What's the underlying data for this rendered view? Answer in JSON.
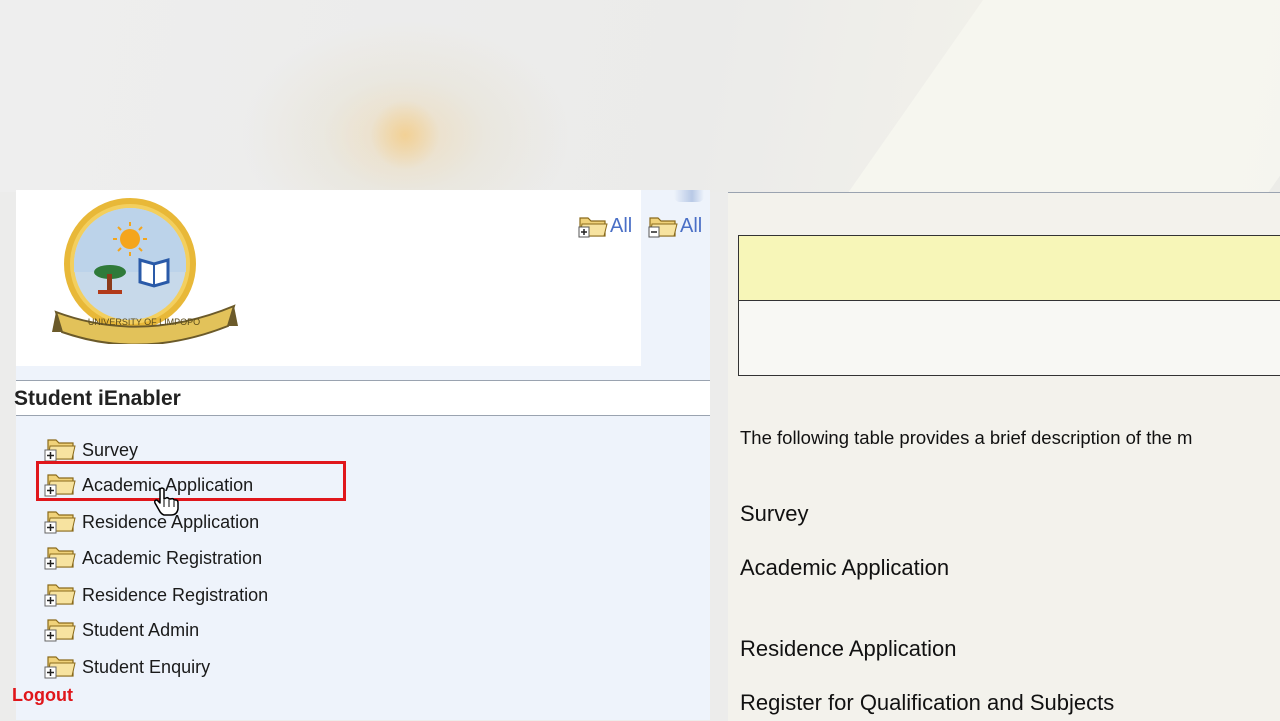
{
  "header": {
    "title": "Student iEnabler",
    "expand_all_label": "All",
    "collapse_all_label": "All",
    "logo_icon": "university-of-limpopo-logo",
    "logo_text": "UNIVERSITY OF LIMPOPO"
  },
  "sidebar": {
    "items": [
      {
        "label": "Survey",
        "icon": "folder-plus-icon"
      },
      {
        "label": "Academic Application",
        "icon": "folder-plus-icon",
        "selected": true
      },
      {
        "label": "Residence Application",
        "icon": "folder-plus-icon"
      },
      {
        "label": "Academic Registration",
        "icon": "folder-plus-icon"
      },
      {
        "label": "Residence Registration",
        "icon": "folder-plus-icon"
      },
      {
        "label": "Student Admin",
        "icon": "folder-plus-icon"
      },
      {
        "label": "Student Enquiry",
        "icon": "folder-plus-icon"
      }
    ],
    "logout_label": "Logout",
    "logout_visible_text": "Logout"
  },
  "main": {
    "intro": "The following table provides a brief description of the m",
    "items": [
      "Survey",
      "Academic Application",
      "Residence Application",
      "Register for Qualification and Subjects"
    ]
  },
  "colors": {
    "highlight": "#e0161b",
    "link_blue": "#4a6fc6",
    "left_panel_bg": "#eef3fb",
    "table_header_yellow": "#f7f6b8"
  }
}
